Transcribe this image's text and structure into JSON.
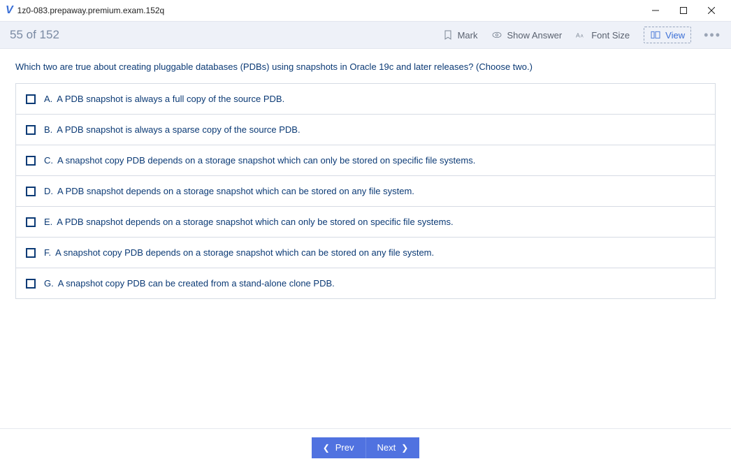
{
  "window": {
    "title": "1z0-083.prepaway.premium.exam.152q"
  },
  "toolbar": {
    "counter": "55 of 152",
    "mark": "Mark",
    "show_answer": "Show Answer",
    "font_size": "Font Size",
    "view": "View"
  },
  "question": "Which two are true about creating pluggable databases (PDBs) using snapshots in Oracle 19c and later releases? (Choose two.)",
  "options": [
    {
      "letter": "A.",
      "text": "A PDB snapshot is always a full copy of the source PDB."
    },
    {
      "letter": "B.",
      "text": "A PDB snapshot is always a sparse copy of the source PDB."
    },
    {
      "letter": "C.",
      "text": "A snapshot copy PDB depends on a storage snapshot which can only be stored on specific file systems."
    },
    {
      "letter": "D.",
      "text": "A PDB snapshot depends on a storage snapshot which can be stored on any file system."
    },
    {
      "letter": "E.",
      "text": "A PDB snapshot depends on a storage snapshot which can only be stored on specific file systems."
    },
    {
      "letter": "F.",
      "text": "A snapshot copy PDB depends on a storage snapshot which can be stored on any file system."
    },
    {
      "letter": "G.",
      "text": "A snapshot copy PDB can be created from a stand-alone clone PDB."
    }
  ],
  "nav": {
    "prev": "Prev",
    "next": "Next"
  }
}
